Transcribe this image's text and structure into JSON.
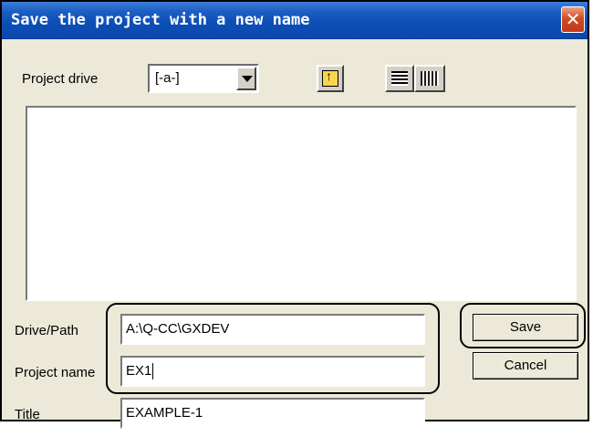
{
  "window": {
    "title": "Save the project with a new name",
    "close_symbol": "✕"
  },
  "drive": {
    "label": "Project drive",
    "value": "[-a-]"
  },
  "fields": {
    "drive_path": {
      "label": "Drive/Path",
      "value": "A:\\Q-CC\\GXDEV"
    },
    "project_name": {
      "label": "Project name",
      "value": "EX1"
    },
    "title": {
      "label": "Title",
      "value": "EXAMPLE-1"
    }
  },
  "buttons": {
    "save": "Save",
    "cancel": "Cancel"
  },
  "toolbar": {
    "icons": [
      "folder-up-icon",
      "list-view-icon",
      "details-view-icon"
    ]
  }
}
